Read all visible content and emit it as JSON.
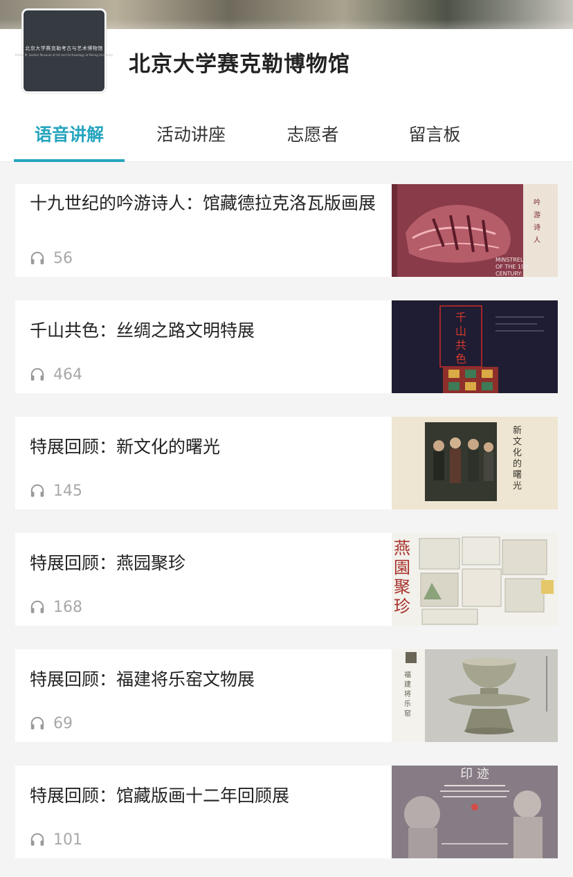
{
  "header": {
    "museum_name": "北京大学赛克勒博物馆",
    "logo_text_cn": "北京大学赛克勒考古与艺术博物馆",
    "logo_text_en": "Arthur M. Sackler Museum of Art and Archaeology at Peking University"
  },
  "tabs": [
    {
      "label": "语音讲解",
      "active": true
    },
    {
      "label": "活动讲座",
      "active": false
    },
    {
      "label": "志愿者",
      "active": false
    },
    {
      "label": "留言板",
      "active": false
    }
  ],
  "items": [
    {
      "title": "十九世纪的吟游诗人：馆藏德拉克洛瓦版画展",
      "plays": "56",
      "thumb_icon": "poster-tiger-minstrel"
    },
    {
      "title": "千山共色：丝绸之路文明特展",
      "plays": "464",
      "thumb_icon": "poster-silk-road"
    },
    {
      "title": "特展回顾：新文化的曙光",
      "plays": "145",
      "thumb_icon": "poster-new-culture"
    },
    {
      "title": "特展回顾：燕园聚珍",
      "plays": "168",
      "thumb_icon": "poster-yanyuan"
    },
    {
      "title": "特展回顾：福建将乐窑文物展",
      "plays": "69",
      "thumb_icon": "poster-celadon-cup"
    },
    {
      "title": "特展回顾：馆藏版画十二年回顾展",
      "plays": "101",
      "thumb_icon": "poster-prints"
    }
  ],
  "colors": {
    "accent": "#26a5be",
    "count_gray": "#a8a8a8"
  },
  "icons": {
    "play_count": "headphones-icon"
  }
}
